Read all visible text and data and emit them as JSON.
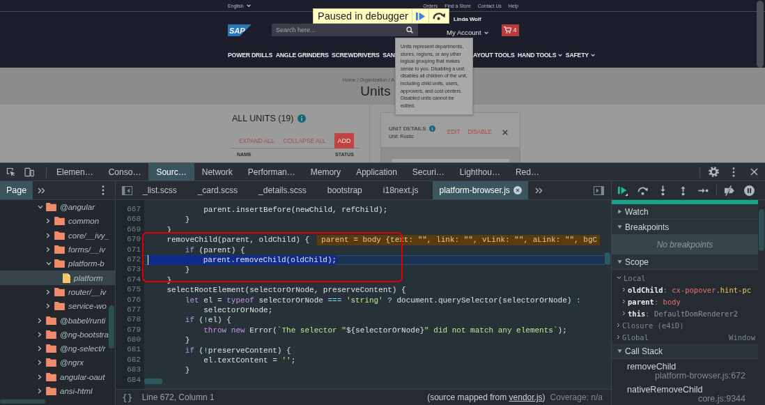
{
  "debugger_banner": {
    "message": "Paused in debugger"
  },
  "site": {
    "language": "English",
    "top_links": [
      "Orders",
      "Find a Store",
      "Contact Us",
      "Help"
    ],
    "logo": "SAP",
    "search": {
      "placeholder": "Search here..."
    },
    "account": {
      "name": "Linda Wolf",
      "menu": "My Account"
    },
    "cart": {
      "count": "4"
    },
    "categories": [
      {
        "label": "POWER DRILLS",
        "dropdown": false,
        "covered_end": false,
        "covered_start": false
      },
      {
        "label": "ANGLE GRINDERS",
        "dropdown": false,
        "covered_end": false,
        "covered_start": false
      },
      {
        "label": "SCREWDRIVERS",
        "dropdown": false,
        "covered_end": false,
        "covered_start": false
      },
      {
        "label": "SAN",
        "dropdown": false,
        "covered_end": true,
        "covered_start": false
      },
      {
        "label": "AYOUT TOOLS",
        "dropdown": false,
        "covered_end": false,
        "covered_start": true
      },
      {
        "label": "HAND TOOLS",
        "dropdown": true,
        "covered_end": false,
        "covered_start": false
      },
      {
        "label": "SAFETY",
        "dropdown": true,
        "covered_end": false,
        "covered_start": false
      }
    ],
    "popover": {
      "text": "Units represent departments, stores, regions, or any other logical grouping that makes sense to you. Disabling a unit disables all children of the unit, including child units, users, approvers, and cost centers. Disabled units cannot be edited."
    },
    "breadcrumb": "Home / Organization / A",
    "title": "Units",
    "units_list": {
      "title": "ALL UNITS (19)",
      "actions": [
        {
          "label": "EXPAND ALL",
          "kind": "link"
        },
        {
          "label": "COLLAPSE ALL",
          "kind": "link"
        },
        {
          "label": "ADD",
          "kind": "primary"
        }
      ],
      "columns": [
        "NAME",
        "STATUS"
      ]
    },
    "unit_details": {
      "title": "UNIT DETAILS",
      "subtitle": "Unit: Rustic",
      "actions": [
        "EDIT",
        "DISABLE"
      ]
    }
  },
  "devtools": {
    "panel_tabs": [
      {
        "label": "Elemen…",
        "selected": false
      },
      {
        "label": "Conso…",
        "selected": false
      },
      {
        "label": "Sourc…",
        "selected": true
      },
      {
        "label": "Network",
        "selected": false
      },
      {
        "label": "Performan…",
        "selected": false
      },
      {
        "label": "Memory",
        "selected": false
      },
      {
        "label": "Application",
        "selected": false
      },
      {
        "label": "Securi…",
        "selected": false
      },
      {
        "label": "Lighthou…",
        "selected": false
      },
      {
        "label": "Red…",
        "selected": false
      }
    ],
    "navigator": {
      "tabs": [
        {
          "label": "Page",
          "selected": true
        }
      ],
      "tree": [
        {
          "label": "@angular",
          "kind": "folder",
          "expanded": true,
          "selected": false,
          "children": [
            {
              "label": "common",
              "kind": "folder",
              "expanded": false,
              "selected": false
            },
            {
              "label": "core/__ivy_",
              "kind": "folder",
              "expanded": false,
              "selected": false
            },
            {
              "label": "forms/__iv",
              "kind": "folder",
              "expanded": false,
              "selected": false
            },
            {
              "label": "platform-b",
              "kind": "folder",
              "expanded": true,
              "selected": false,
              "children": [
                {
                  "label": "platform",
                  "kind": "file",
                  "selected": true
                }
              ]
            },
            {
              "label": "router/__iv",
              "kind": "folder",
              "expanded": false,
              "selected": false
            },
            {
              "label": "service-wo",
              "kind": "folder",
              "expanded": false,
              "selected": false
            }
          ]
        },
        {
          "label": "@babel/runti",
          "kind": "folder",
          "expanded": false,
          "selected": false
        },
        {
          "label": "@ng-bootstra",
          "kind": "folder",
          "expanded": false,
          "selected": false
        },
        {
          "label": "@ng-select/r",
          "kind": "folder",
          "expanded": false,
          "selected": false
        },
        {
          "label": "@ngrx",
          "kind": "folder",
          "expanded": false,
          "selected": false
        },
        {
          "label": "angular-oaut",
          "kind": "folder",
          "expanded": false,
          "selected": false
        },
        {
          "label": "ansi-html",
          "kind": "folder",
          "expanded": false,
          "selected": false
        }
      ]
    },
    "editor": {
      "tabs": [
        {
          "label": "_list.scss",
          "selected": false,
          "closable": false
        },
        {
          "label": "_card.scss",
          "selected": false,
          "closable": false
        },
        {
          "label": "_details.scss",
          "selected": false,
          "closable": false
        },
        {
          "label": "bootstrap",
          "selected": false,
          "closable": false
        },
        {
          "label": "i18next.js",
          "selected": false,
          "closable": false
        },
        {
          "label": "platform-browser.js",
          "selected": true,
          "closable": true
        }
      ],
      "lines": [
        {
          "kind": "line",
          "number": "667",
          "current": false,
          "tokens": [
            {
              "text": "            parent.insertBefore(newChild, refChild);",
              "kind": "plain"
            }
          ]
        },
        {
          "kind": "line",
          "number": "668",
          "current": false,
          "tokens": [
            {
              "text": "        }",
              "kind": "plain"
            }
          ]
        },
        {
          "kind": "line",
          "number": "669",
          "current": false,
          "tokens": [
            {
              "text": "    }",
              "kind": "plain"
            }
          ]
        },
        {
          "kind": "framed_group",
          "lines": [
            {
              "number": "670",
              "current": false,
              "tokens": [
                {
                  "text": "    removeChild(parent, oldChild) {",
                  "kind": "plain"
                }
              ],
              "inline_value": "parent = body {text: \"\", link: \"\", vLink: \"\", aLink: \"\", bgC"
            },
            {
              "number": "671",
              "current": false,
              "tokens": [
                {
                  "text": "        if",
                  "kind": "keyword"
                },
                {
                  "text": " (parent) {",
                  "kind": "plain"
                }
              ]
            },
            {
              "number": "672",
              "current": true,
              "tokens": [
                {
                  "text": "            parent.removeChild(oldChild);",
                  "kind": "plain"
                }
              ]
            },
            {
              "number": "673",
              "current": false,
              "tokens": [
                {
                  "text": "        }",
                  "kind": "plain"
                }
              ]
            },
            {
              "number": "674",
              "current": false,
              "tokens": [
                {
                  "text": "    }",
                  "kind": "plain"
                }
              ]
            }
          ]
        },
        {
          "kind": "line",
          "number": "675",
          "current": false,
          "tokens": [
            {
              "text": "    selectRootElement(selectorOrNode, preserveContent) {",
              "kind": "plain"
            }
          ]
        },
        {
          "kind": "line",
          "number": "676",
          "current": false,
          "tokens": [
            {
              "text": "        let",
              "kind": "keyword"
            },
            {
              "text": " el = ",
              "kind": "plain"
            },
            {
              "text": "typeof",
              "kind": "keyword"
            },
            {
              "text": " selectorOrNode ",
              "kind": "plain"
            },
            {
              "text": "===",
              "kind": "operator"
            },
            {
              "text": " 'string'",
              "kind": "string"
            },
            {
              "text": " ?",
              "kind": "operator"
            },
            {
              "text": " document.querySelector(selectorOrNode) ",
              "kind": "plain"
            },
            {
              "text": ":",
              "kind": "operator"
            }
          ]
        },
        {
          "kind": "line",
          "number": "677",
          "current": false,
          "tokens": [
            {
              "text": "            selectorOrNode;",
              "kind": "plain"
            }
          ]
        },
        {
          "kind": "line",
          "number": "678",
          "current": false,
          "tokens": [
            {
              "text": "        if",
              "kind": "keyword"
            },
            {
              "text": " (",
              "kind": "plain"
            },
            {
              "text": "!",
              "kind": "operator"
            },
            {
              "text": "el) {",
              "kind": "plain"
            }
          ]
        },
        {
          "kind": "line",
          "number": "679",
          "current": false,
          "tokens": [
            {
              "text": "            throw",
              "kind": "keyword"
            },
            {
              "text": " new",
              "kind": "keyword"
            },
            {
              "text": " Error(",
              "kind": "plain"
            },
            {
              "text": "`The selector \"",
              "kind": "string"
            },
            {
              "text": "${selectorOrNode}",
              "kind": "plain"
            },
            {
              "text": "\" did not match any elements`",
              "kind": "string"
            },
            {
              "text": ");",
              "kind": "plain"
            }
          ]
        },
        {
          "kind": "line",
          "number": "680",
          "current": false,
          "tokens": [
            {
              "text": "        }",
              "kind": "plain"
            }
          ]
        },
        {
          "kind": "line",
          "number": "681",
          "current": false,
          "tokens": [
            {
              "text": "        if",
              "kind": "keyword"
            },
            {
              "text": " (",
              "kind": "plain"
            },
            {
              "text": "!",
              "kind": "operator"
            },
            {
              "text": "preserveContent) {",
              "kind": "plain"
            }
          ]
        },
        {
          "kind": "line",
          "number": "682",
          "current": false,
          "tokens": [
            {
              "text": "            el.textContent = ",
              "kind": "plain"
            },
            {
              "text": "''",
              "kind": "string"
            },
            {
              "text": ";",
              "kind": "plain"
            }
          ]
        },
        {
          "kind": "line",
          "number": "683",
          "current": false,
          "tokens": [
            {
              "text": "        }",
              "kind": "plain"
            }
          ]
        },
        {
          "kind": "line",
          "number": "684",
          "current": false
        }
      ],
      "pretty_print": "{}",
      "position": "Line 672, Column 1",
      "source_map": {
        "before": "(source mapped from ",
        "file": "vendor.js",
        "after": ")"
      },
      "coverage": "Coverage: n/a"
    },
    "debugger": {
      "paused": true,
      "sections": [
        {
          "title": "Watch",
          "expanded": false
        },
        {
          "title": "Breakpoints",
          "expanded": true,
          "empty_message": "No breakpoints"
        },
        {
          "title": "Scope",
          "expanded": true,
          "scopes": [
            {
              "name": "Local",
              "expanded": true,
              "variables": [
                {
                  "name": "oldChild",
                  "expanded": false,
                  "value_parts": [
                    {
                      "text": ": ",
                      "kind": "punctuation"
                    },
                    {
                      "text": "cx-popover",
                      "kind": "tag"
                    },
                    {
                      "text": ".hint-pc",
                      "kind": "class"
                    }
                  ]
                },
                {
                  "name": "parent",
                  "expanded": false,
                  "value_parts": [
                    {
                      "text": ": ",
                      "kind": "punctuation"
                    },
                    {
                      "text": "body",
                      "kind": "tag"
                    }
                  ]
                },
                {
                  "name": "this",
                  "expanded": false,
                  "value_parts": [
                    {
                      "text": ": ",
                      "kind": "punctuation"
                    },
                    {
                      "text": "DefaultDomRenderer2",
                      "kind": "object"
                    }
                  ]
                }
              ]
            },
            {
              "name": "Closure (e4iD)",
              "expanded": false
            },
            {
              "name": "Global",
              "expanded": false,
              "value": "Window"
            }
          ]
        },
        {
          "title": "Call Stack",
          "expanded": true,
          "frames": [
            {
              "function": "removeChild",
              "location": "platform-browser.js:672"
            },
            {
              "function": "nativeRemoveChild",
              "location": "core.js:9344"
            }
          ]
        }
      ]
    }
  }
}
